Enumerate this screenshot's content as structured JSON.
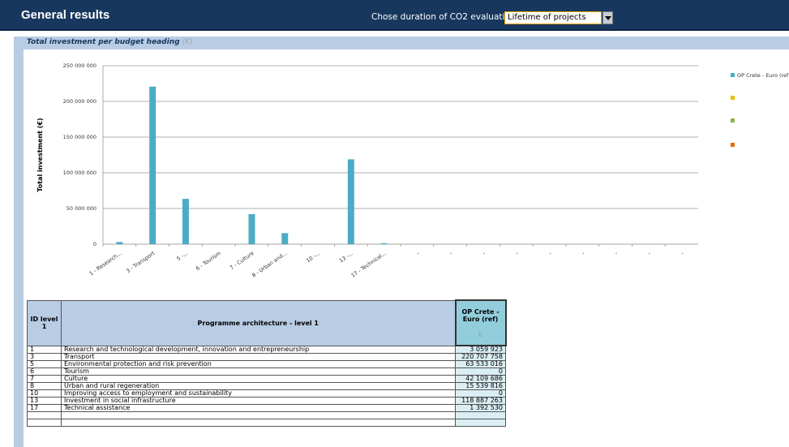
{
  "header": {
    "title": "General results",
    "duration_label": "Chose duration of CO2 evaluation :",
    "duration_value": "Lifetime of projects"
  },
  "section": {
    "title": "Total investment per budget heading",
    "unit": "(€)"
  },
  "chart_data": {
    "type": "bar",
    "title": "",
    "ylabel": "Total investment  (€)",
    "xlabel": "",
    "ylim": [
      0,
      250000000
    ],
    "yticks": [
      0,
      50000000,
      100000000,
      150000000,
      200000000,
      250000000
    ],
    "ytick_labels": [
      "0",
      "50 000 000",
      "100 000 000",
      "150 000 000",
      "200 000 000",
      "250 000 000"
    ],
    "categories": [
      "1 - Research...",
      "3 - Transport",
      "5 -...",
      "6 - Tourism",
      "7 - Culture",
      "8 - Urban and...",
      "10 -...",
      "13 -...",
      "17 - Technical...",
      "-",
      "-",
      "-",
      "-",
      "-",
      "-",
      "-",
      "-",
      "-"
    ],
    "series": [
      {
        "name": "OP Crete - Euro (ref)",
        "color": "#4bacc6",
        "values": [
          3059923,
          220707758,
          63533016,
          0,
          42109686,
          15539816,
          0,
          118887263,
          1392530,
          0,
          0,
          0,
          0,
          0,
          0,
          0,
          0,
          0
        ]
      }
    ],
    "legend": {
      "placement": "right",
      "entries": [
        {
          "label": "OP Crete - Euro (ref)",
          "color": "#4bacc6"
        },
        {
          "label": "",
          "color": "#e8c000"
        },
        {
          "label": "",
          "color": "#8db548"
        },
        {
          "label": "",
          "color": "#e46c0a"
        }
      ]
    },
    "grid": true
  },
  "table": {
    "headers": {
      "id": "ID level 1",
      "architecture": "Programme architecture - level 1",
      "euro": "OP Crete - Euro (ref)",
      "euro_unit": "€"
    },
    "rows": [
      {
        "id": "1",
        "label": "Research and technological development, innovation and entrepreneurship",
        "value": "3 059 923"
      },
      {
        "id": "3",
        "label": "Transport",
        "value": "220 707 758"
      },
      {
        "id": "5",
        "label": "Environmental protection and risk prevention",
        "value": "63 533 016"
      },
      {
        "id": "6",
        "label": "Tourism",
        "value": "0"
      },
      {
        "id": "7",
        "label": "Culture",
        "value": "42 109 686"
      },
      {
        "id": "8",
        "label": "Urban and rural regeneration",
        "value": "15 539 816"
      },
      {
        "id": "10",
        "label": "Improving access to employment and sustainability",
        "value": "0"
      },
      {
        "id": "13",
        "label": "Investment in social infrastructure",
        "value": "118 887 263"
      },
      {
        "id": "17",
        "label": "Technical assistance",
        "value": "1 392 530"
      },
      {
        "id": "",
        "label": "",
        "value": ""
      },
      {
        "id": "",
        "label": "",
        "value": ""
      }
    ]
  }
}
